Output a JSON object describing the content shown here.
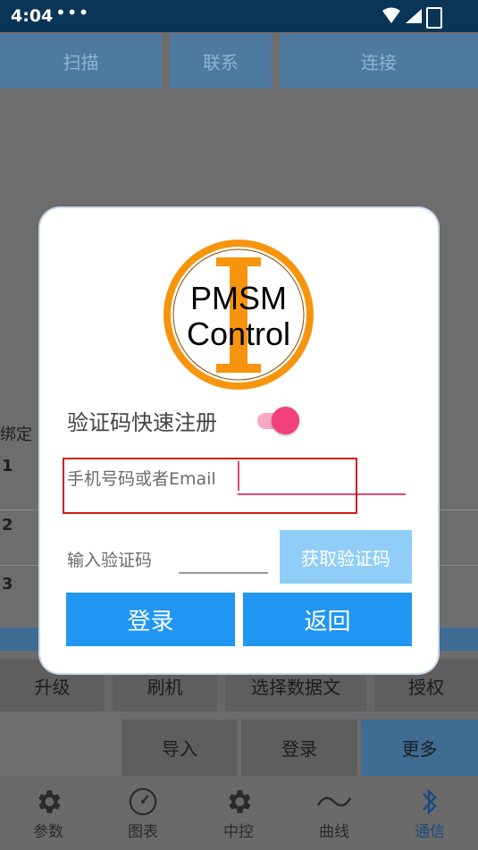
{
  "status_bar": {
    "time": "4:04",
    "more": "•••"
  },
  "top_buttons": {
    "scan": "扫描",
    "contact": "联系",
    "connect": "连接"
  },
  "background": {
    "bind_label": "绑定",
    "rows": [
      "1",
      "2",
      "3"
    ]
  },
  "actions_row1": [
    "升级",
    "刷机",
    "选择数据文",
    "授权"
  ],
  "actions_row2": [
    "导入",
    "登录",
    "更多"
  ],
  "nav": [
    {
      "label": "参数",
      "icon": "gear-icon"
    },
    {
      "label": "图表",
      "icon": "gauge-icon"
    },
    {
      "label": "中控",
      "icon": "gear-icon"
    },
    {
      "label": "曲线",
      "icon": "wave-icon"
    },
    {
      "label": "通信",
      "icon": "bluetooth-icon",
      "active": true
    }
  ],
  "dialog": {
    "logo": {
      "line1": "PMSM",
      "line2": "Control",
      "ring_color": "#f7940d"
    },
    "quick_register_label": "验证码快速注册",
    "quick_register_on": true,
    "phone_placeholder": "手机号码或者Email",
    "code_label": "输入验证码",
    "get_code_label": "获取验证码",
    "login_label": "登录",
    "back_label": "返回"
  },
  "colors": {
    "primary": "#2196f3",
    "accent": "#f13f7c",
    "highlight_box": "#d61a1a"
  }
}
